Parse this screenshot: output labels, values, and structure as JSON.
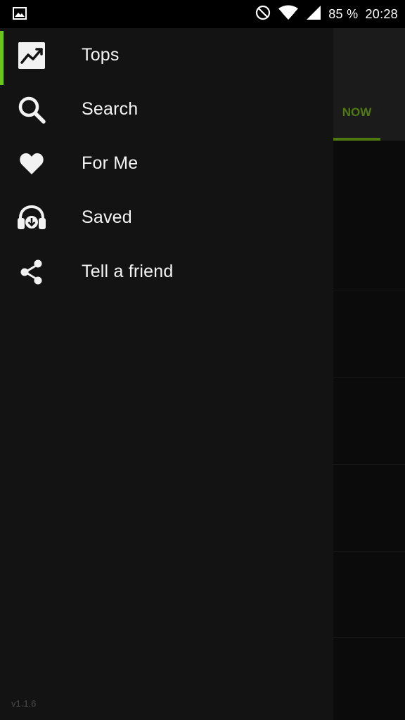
{
  "status_bar": {
    "battery": "85 %",
    "time": "20:28",
    "icons": [
      "image-notification-icon",
      "do-not-disturb-icon",
      "wifi-icon",
      "signal-icon"
    ]
  },
  "background_app": {
    "visible_tab": "NOW",
    "accent_color": "#4f7a12"
  },
  "drawer": {
    "accent_color": "#6cc51c",
    "items": [
      {
        "label": "Tops",
        "icon": "trending-chart-icon",
        "active": true
      },
      {
        "label": "Search",
        "icon": "search-icon",
        "active": false
      },
      {
        "label": "For Me",
        "icon": "heart-icon",
        "active": false
      },
      {
        "label": "Saved",
        "icon": "headphones-download-icon",
        "active": false
      },
      {
        "label": "Tell a friend",
        "icon": "share-icon",
        "active": false
      }
    ],
    "version": "v1.1.6"
  }
}
